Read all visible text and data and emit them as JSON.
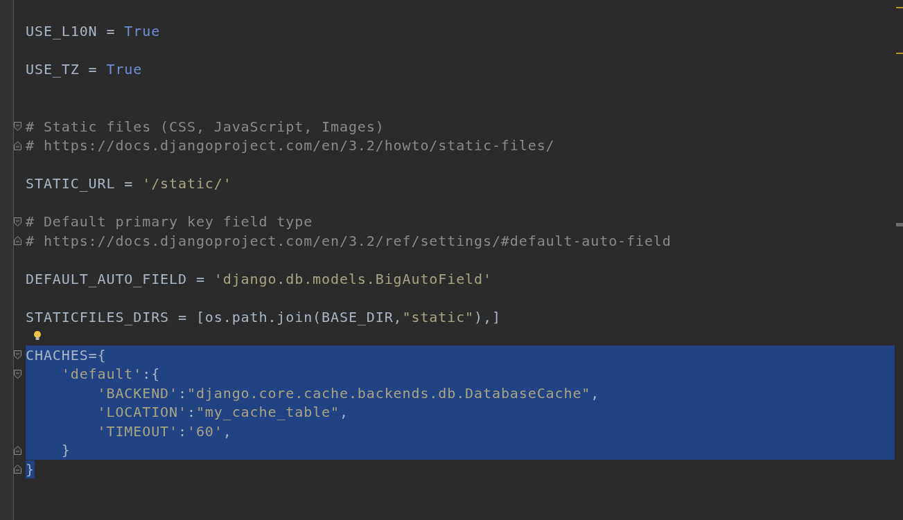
{
  "lines": [
    {
      "selected": false,
      "fold_start": false,
      "fold_end": false,
      "bulb": false
    },
    {
      "selected": false,
      "fold_start": false,
      "fold_end": false,
      "bulb": false,
      "tokens": [
        {
          "kind": "plain",
          "text": "USE_L10N = "
        },
        {
          "kind": "keyword",
          "text": "True"
        }
      ]
    },
    {
      "selected": false,
      "fold_start": false,
      "fold_end": false,
      "bulb": false
    },
    {
      "selected": false,
      "fold_start": false,
      "fold_end": false,
      "bulb": false,
      "tokens": [
        {
          "kind": "plain",
          "text": "USE_TZ = "
        },
        {
          "kind": "keyword",
          "text": "True"
        }
      ]
    },
    {
      "selected": false,
      "fold_start": false,
      "fold_end": false,
      "bulb": false
    },
    {
      "selected": false,
      "fold_start": false,
      "fold_end": false,
      "bulb": false
    },
    {
      "selected": false,
      "fold_start": true,
      "fold_end": false,
      "bulb": false,
      "tokens": [
        {
          "kind": "comment",
          "text": "# Static files (CSS, JavaScript, Images)"
        }
      ]
    },
    {
      "selected": false,
      "fold_start": false,
      "fold_end": true,
      "bulb": false,
      "tokens": [
        {
          "kind": "comment",
          "text": "# https://docs.djangoproject.com/en/3.2/howto/static-files/"
        }
      ]
    },
    {
      "selected": false,
      "fold_start": false,
      "fold_end": false,
      "bulb": false
    },
    {
      "selected": false,
      "fold_start": false,
      "fold_end": false,
      "bulb": false,
      "tokens": [
        {
          "kind": "plain",
          "text": "STATIC_URL = "
        },
        {
          "kind": "string",
          "text": "'/static/'"
        }
      ]
    },
    {
      "selected": false,
      "fold_start": false,
      "fold_end": false,
      "bulb": false
    },
    {
      "selected": false,
      "fold_start": true,
      "fold_end": false,
      "bulb": false,
      "tokens": [
        {
          "kind": "comment",
          "text": "# Default primary key field type"
        }
      ]
    },
    {
      "selected": false,
      "fold_start": false,
      "fold_end": true,
      "bulb": false,
      "tokens": [
        {
          "kind": "comment",
          "text": "# https://docs.djangoproject.com/en/3.2/ref/settings/#default-auto-field"
        }
      ]
    },
    {
      "selected": false,
      "fold_start": false,
      "fold_end": false,
      "bulb": false
    },
    {
      "selected": false,
      "fold_start": false,
      "fold_end": false,
      "bulb": false,
      "tokens": [
        {
          "kind": "plain",
          "text": "DEFAULT_AUTO_FIELD = "
        },
        {
          "kind": "string",
          "text": "'django.db.models.BigAutoField'"
        }
      ]
    },
    {
      "selected": false,
      "fold_start": false,
      "fold_end": false,
      "bulb": false
    },
    {
      "selected": false,
      "fold_start": false,
      "fold_end": false,
      "bulb": false,
      "tokens": [
        {
          "kind": "plain",
          "text": "STATICFILES_DIRS = [os.path.join(BASE_DIR,"
        },
        {
          "kind": "string",
          "text": "\"static\""
        },
        {
          "kind": "plain",
          "text": "),]"
        }
      ]
    },
    {
      "selected": false,
      "fold_start": false,
      "fold_end": false,
      "bulb": true
    },
    {
      "selected": true,
      "partial": false,
      "fold_start": true,
      "fold_end": false,
      "bulb": false,
      "tokens": [
        {
          "kind": "plain",
          "text": "CHACHES={"
        }
      ]
    },
    {
      "selected": true,
      "partial": false,
      "fold_start": true,
      "fold_end": false,
      "bulb": false,
      "tokens": [
        {
          "kind": "string",
          "text": "    'default'"
        },
        {
          "kind": "plain",
          "text": ":{"
        }
      ]
    },
    {
      "selected": true,
      "partial": false,
      "fold_start": false,
      "fold_end": false,
      "bulb": false,
      "tokens": [
        {
          "kind": "string",
          "text": "        'BACKEND'"
        },
        {
          "kind": "plain",
          "text": ":"
        },
        {
          "kind": "string",
          "text": "\"django.core.cache.backends.db.DatabaseCache\""
        },
        {
          "kind": "plain",
          "text": ","
        }
      ]
    },
    {
      "selected": true,
      "partial": false,
      "fold_start": false,
      "fold_end": false,
      "bulb": false,
      "tokens": [
        {
          "kind": "string",
          "text": "        'LOCATION'"
        },
        {
          "kind": "plain",
          "text": ":"
        },
        {
          "kind": "string",
          "text": "\"my_cache_table\""
        },
        {
          "kind": "plain",
          "text": ","
        }
      ]
    },
    {
      "selected": true,
      "partial": false,
      "fold_start": false,
      "fold_end": false,
      "bulb": false,
      "tokens": [
        {
          "kind": "string",
          "text": "        'TIMEOUT'"
        },
        {
          "kind": "plain",
          "text": ":"
        },
        {
          "kind": "string",
          "text": "'60'"
        },
        {
          "kind": "plain",
          "text": ","
        }
      ]
    },
    {
      "selected": true,
      "partial": false,
      "fold_start": false,
      "fold_end": true,
      "bulb": false,
      "tokens": [
        {
          "kind": "plain",
          "text": "    }"
        }
      ]
    },
    {
      "selected": true,
      "partial": true,
      "fold_start": false,
      "fold_end": true,
      "bulb": false,
      "tokens": [
        {
          "kind": "plain",
          "text": "}"
        }
      ]
    }
  ]
}
